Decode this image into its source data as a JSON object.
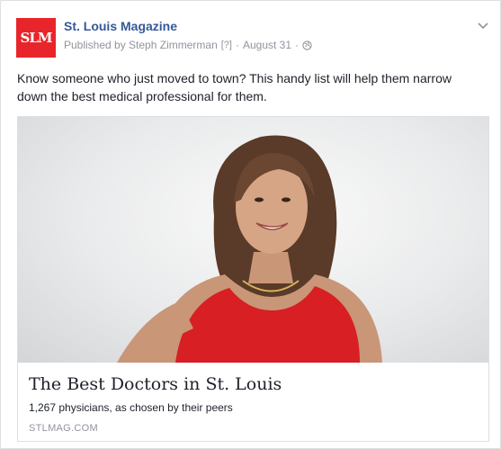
{
  "post": {
    "avatar_text": "SLM",
    "page_name": "St. Louis Magazine",
    "published_by": "Published by Steph Zimmerman",
    "help_mark": "[?]",
    "separator": "·",
    "date": "August 31",
    "privacy_icon": "globe-icon",
    "menu_icon": "chevron-down-icon",
    "text": "Know someone who just moved to town? This handy list will help them narrow down the best medical professional for them."
  },
  "link_preview": {
    "image_alt": "Smiling woman in red sleeveless top",
    "title": "The Best Doctors in St. Louis",
    "description": "1,267 physicians, as chosen by their peers",
    "domain": "STLMAG.COM"
  },
  "colors": {
    "brand_red": "#e8252b",
    "link_blue": "#365899",
    "meta_gray": "#90949c"
  }
}
